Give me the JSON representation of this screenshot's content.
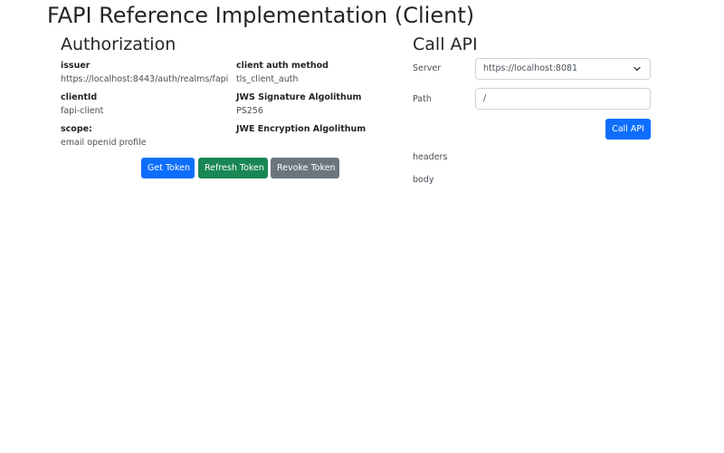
{
  "header": {
    "title": "FAPI Reference Implementation (Client)"
  },
  "authorization": {
    "title": "Authorization",
    "fields": {
      "issuer": {
        "label": "issuer",
        "value": "https://localhost:8443/auth/realms/fapi"
      },
      "client_auth_method": {
        "label": "client auth method",
        "value": "tls_client_auth"
      },
      "client_id": {
        "label": "clientId",
        "value": "fapi-client"
      },
      "jws_signature": {
        "label": "JWS Signature Algolithum",
        "value": "PS256"
      },
      "scope": {
        "label": "scope:",
        "value": "email openid profile"
      },
      "jwe_encryption": {
        "label": "JWE Encryption Algolithum",
        "value": ""
      }
    },
    "buttons": {
      "get_token": "Get Token",
      "refresh_token": "Refresh Token",
      "revoke_token": "Revoke Token"
    }
  },
  "call_api": {
    "title": "Call API",
    "server_label": "Server",
    "server_value": "https://localhost:8081",
    "path_label": "Path",
    "path_value": "/",
    "call_button": "Call API",
    "headers_label": "headers",
    "body_label": "body"
  },
  "colors": {
    "primary": "#0d6efd",
    "success": "#198754",
    "secondary": "#6c757d"
  },
  "icons": {
    "server_select": "chevron-down-icon"
  }
}
